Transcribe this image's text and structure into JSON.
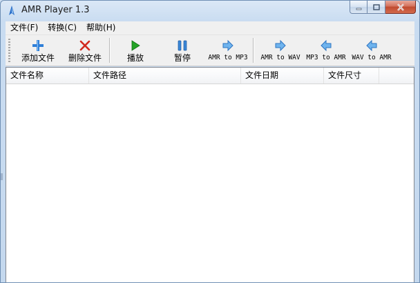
{
  "window": {
    "title": "AMR Player 1.3"
  },
  "menu": [
    {
      "label": "文件(F)"
    },
    {
      "label": "转换(C)"
    },
    {
      "label": "帮助(H)"
    }
  ],
  "toolbar": {
    "add_file": "添加文件",
    "delete_file": "删除文件",
    "play": "播放",
    "pause": "暂停",
    "amr_to_mp3": "AMR to MP3",
    "amr_to_wav": "AMR to WAV",
    "mp3_to_amr": "MP3 to AMR",
    "wav_to_amr": "WAV to AMR"
  },
  "list": {
    "columns": [
      {
        "label": "文件名称"
      },
      {
        "label": "文件路径"
      },
      {
        "label": "文件日期"
      },
      {
        "label": "文件尺寸"
      }
    ],
    "rows": []
  },
  "colors": {
    "add_icon": "#2f7fd8",
    "delete_icon": "#d22a1e",
    "play_icon": "#23a326",
    "pause_icon": "#3a86d6",
    "arrow_icon": "#6fb4ee"
  }
}
